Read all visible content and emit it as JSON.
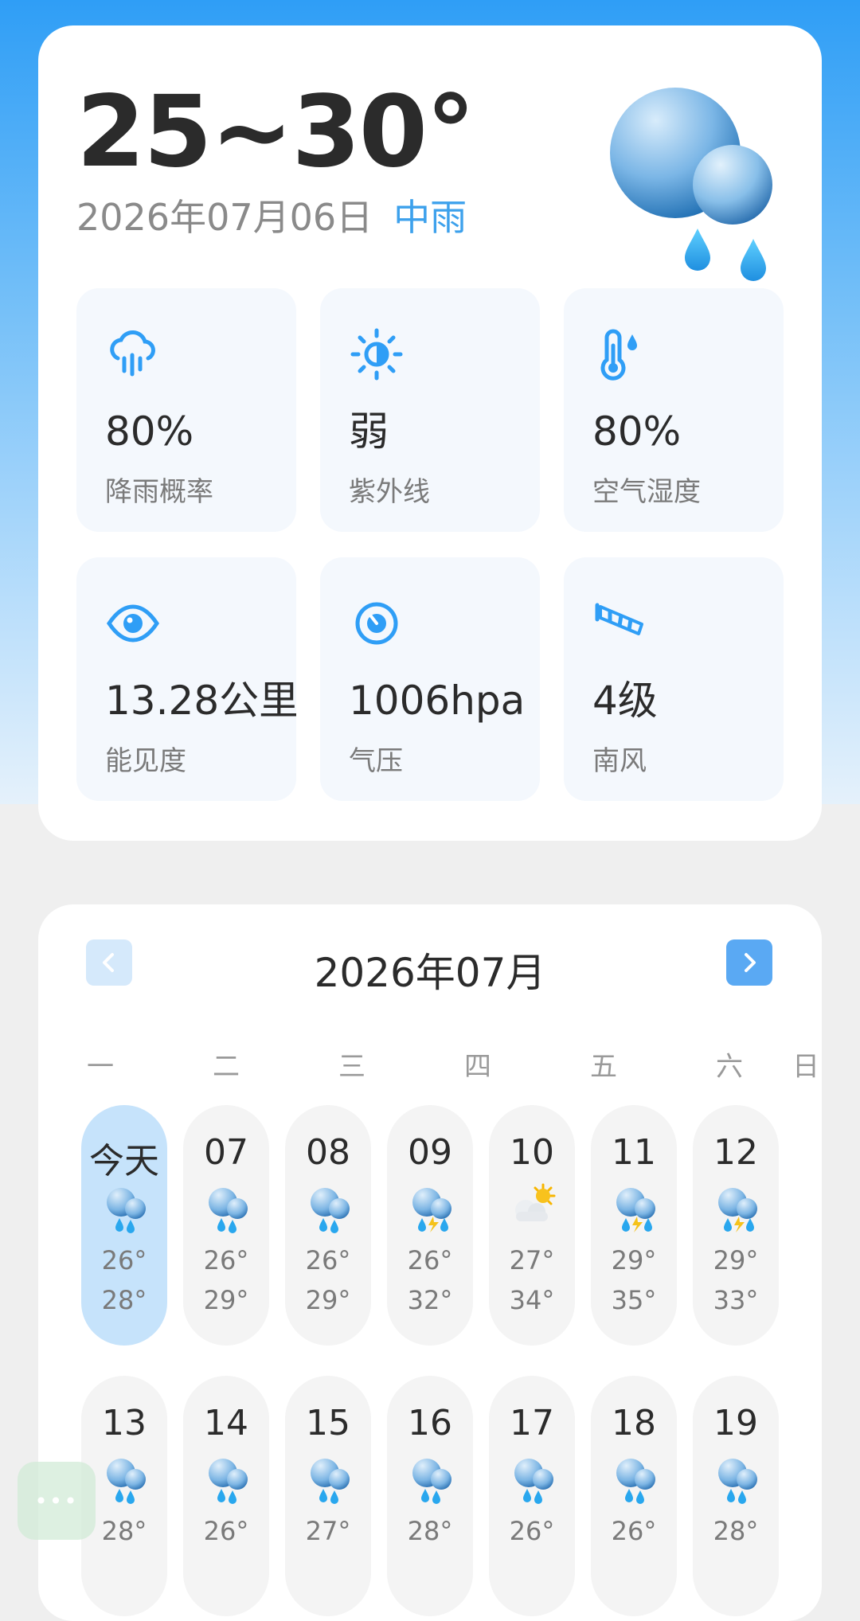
{
  "summary": {
    "temp_range": "25~30°",
    "date": "2026年07月06日",
    "condition": "中雨",
    "icon": "rain-cloud-icon"
  },
  "stats": [
    {
      "icon": "rain-icon",
      "value": "80%",
      "label": "降雨概率"
    },
    {
      "icon": "sun-icon",
      "value": "弱",
      "label": "紫外线"
    },
    {
      "icon": "thermometer-icon",
      "value": "80%",
      "label": "空气湿度"
    },
    {
      "icon": "eye-icon",
      "value": "13.28公里",
      "label": "能见度"
    },
    {
      "icon": "pressure-icon",
      "value": "1006hpa",
      "label": "气压"
    },
    {
      "icon": "windsock-icon",
      "value": "4级",
      "label": "南风"
    }
  ],
  "calendar": {
    "month_title": "2026年07月",
    "weekdays": [
      "一",
      "二",
      "三",
      "四",
      "五",
      "六",
      "日"
    ],
    "days": [
      {
        "label": "今天",
        "icon": "rain",
        "low": "26°",
        "high": "28°"
      },
      {
        "label": "07",
        "icon": "rain",
        "low": "26°",
        "high": "29°"
      },
      {
        "label": "08",
        "icon": "rain",
        "low": "26°",
        "high": "29°"
      },
      {
        "label": "09",
        "icon": "thunder",
        "low": "26°",
        "high": "32°"
      },
      {
        "label": "10",
        "icon": "partly-cloudy",
        "low": "27°",
        "high": "34°"
      },
      {
        "label": "11",
        "icon": "thunder",
        "low": "29°",
        "high": "35°"
      },
      {
        "label": "12",
        "icon": "thunder",
        "low": "29°",
        "high": "33°"
      },
      {
        "label": "13",
        "icon": "rain",
        "low": "28°",
        "high": ""
      },
      {
        "label": "14",
        "icon": "rain",
        "low": "26°",
        "high": ""
      },
      {
        "label": "15",
        "icon": "rain",
        "low": "27°",
        "high": ""
      },
      {
        "label": "16",
        "icon": "rain",
        "low": "28°",
        "high": ""
      },
      {
        "label": "17",
        "icon": "rain",
        "low": "26°",
        "high": ""
      },
      {
        "label": "18",
        "icon": "rain",
        "low": "26°",
        "high": ""
      },
      {
        "label": "19",
        "icon": "rain",
        "low": "28°",
        "high": ""
      }
    ]
  },
  "float_button": {
    "label": "•••",
    "icon": "more-icon"
  },
  "colors": {
    "accent": "#3da1ec",
    "sky_top": "#2f9ef6",
    "today_bg": "#c6e3fb"
  }
}
